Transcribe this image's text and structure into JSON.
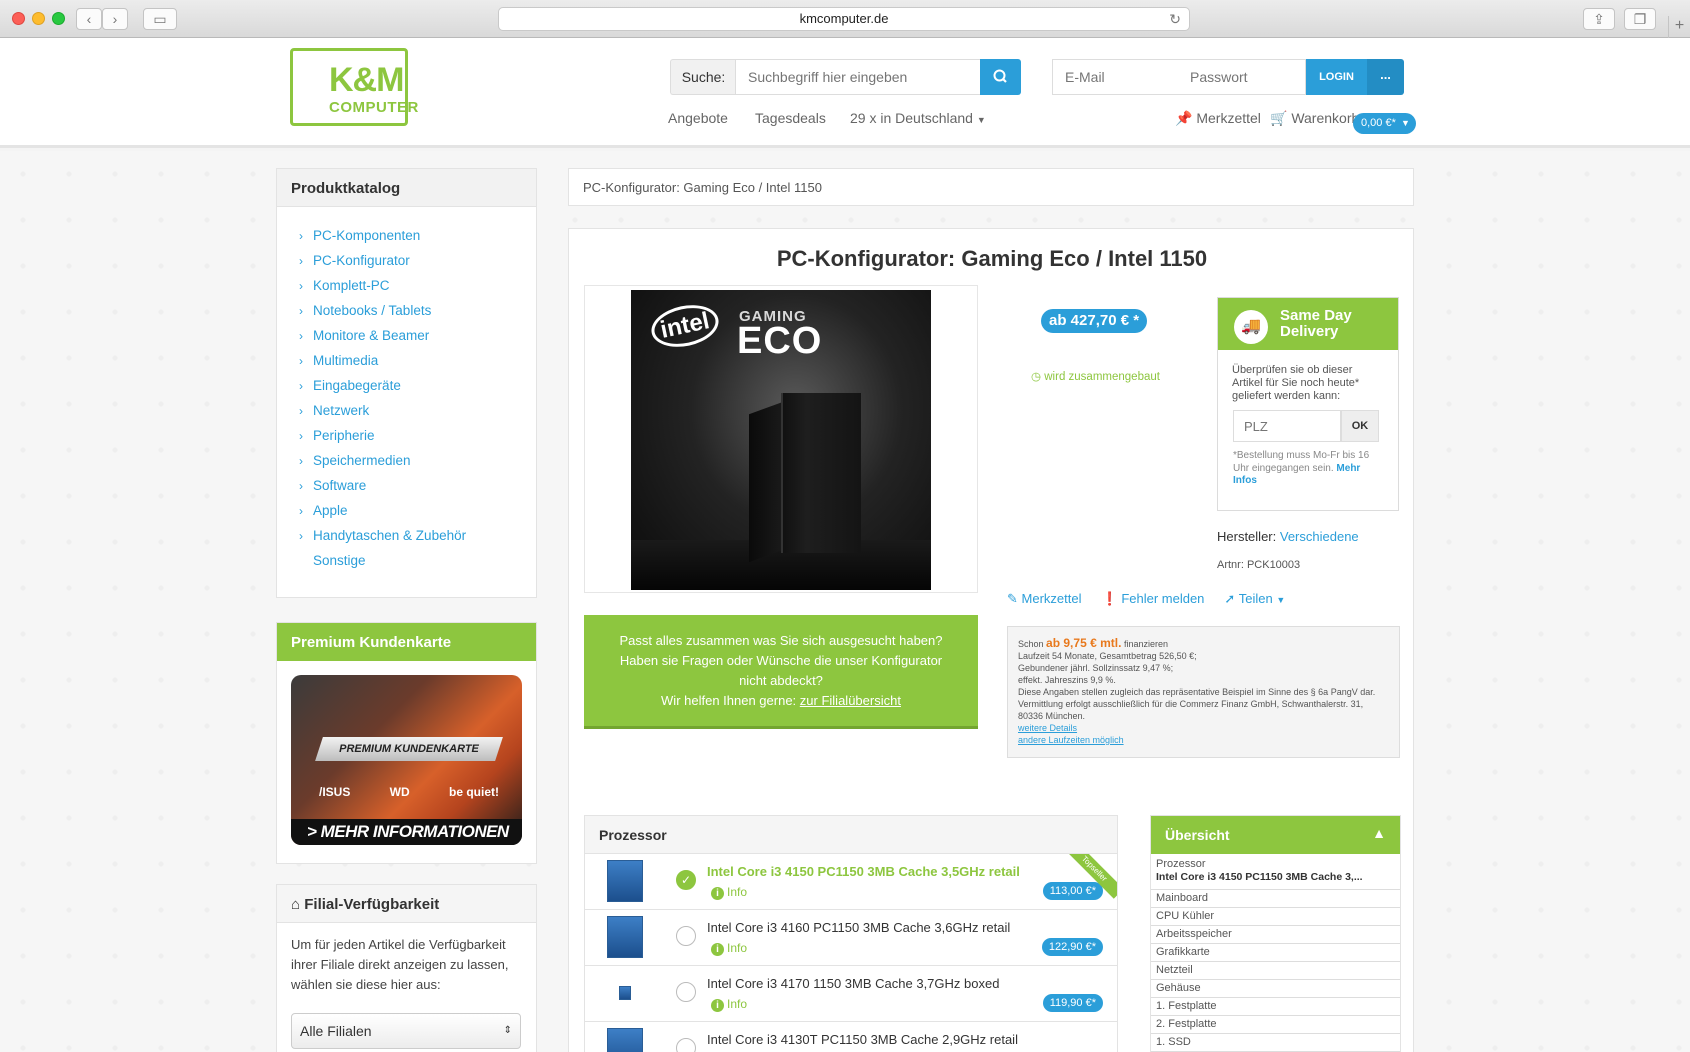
{
  "browser": {
    "url": "kmcomputer.de"
  },
  "header": {
    "logo_line1": "K&M",
    "logo_line2": "COMPUTER",
    "search_label": "Suche:",
    "search_placeholder": "Suchbegriff hier eingeben",
    "email_placeholder": "E-Mail",
    "password_placeholder": "Passwort",
    "login_label": "LOGIN",
    "more_label": "...",
    "nav": [
      "Angebote",
      "Tagesdeals",
      "29 x in Deutschland"
    ],
    "merkzettel": "Merkzettel",
    "warenkorb": "Warenkorb",
    "cart_total": "0,00 €*"
  },
  "sidebar": {
    "catalog_title": "Produktkatalog",
    "categories": [
      "PC-Komponenten",
      "PC-Konfigurator",
      "Komplett-PC",
      "Notebooks / Tablets",
      "Monitore & Beamer",
      "Multimedia",
      "Eingabegeräte",
      "Netzwerk",
      "Peripherie",
      "Speichermedien",
      "Software",
      "Apple",
      "Handytaschen & Zubehör"
    ],
    "categories_extra": "Sonstige",
    "premium_title": "Premium Kundenkarte",
    "card_label": "PREMIUM KUNDENKARTE",
    "card_cta": "> MEHR INFORMATIONEN",
    "card_brands": [
      "/ISUS",
      "WD",
      "be quiet!"
    ],
    "filial_title": "Filial-Verfügbarkeit",
    "filial_text": "Um für jeden Artikel die Verfügbarkeit ihrer Filiale direkt anzeigen zu lassen, wählen sie diese hier aus:",
    "filial_select": "Alle Filialen"
  },
  "breadcrumb": "PC-Konfigurator: Gaming Eco / Intel 1150",
  "product": {
    "title": "PC-Konfigurator: Gaming Eco / Intel 1150",
    "image_intel": "intel",
    "image_gaming": "GAMING",
    "image_eco": "ECO",
    "price": "ab 427,70 € *",
    "assembled": "wird zusammengebaut",
    "manufacturer_label": "Hersteller:",
    "manufacturer": "Verschiedene",
    "artnr": "Artnr: PCK10003",
    "actions": [
      "Merkzettel",
      "Fehler melden",
      "Teilen"
    ]
  },
  "same_day": {
    "title": "Same Day Delivery",
    "text": "Überprüfen sie ob dieser Artikel für Sie noch heute* geliefert werden kann:",
    "plz_placeholder": "PLZ",
    "ok_label": "OK",
    "note": "*Bestellung muss Mo-Fr bis 16 Uhr eingegangen sein.",
    "note_link": "Mehr Infos"
  },
  "help_box": {
    "line1": "Passt alles zusammen was Sie sich ausgesucht haben?",
    "line2": "Haben sie Fragen oder Wünsche die unser Konfigurator nicht abdeckt?",
    "line3": "Wir helfen Ihnen gerne:",
    "link": "zur Filialübersicht"
  },
  "finance": {
    "prefix": "Schon",
    "rate": "ab 9,75 € mtl.",
    "suffix": "finanzieren",
    "lines": [
      "Laufzeit 54 Monate, Gesamtbetrag 526,50 €;",
      "Gebundener jährl. Sollzinssatz 9,47 %;",
      "effekt. Jahreszins 9,9 %.",
      "Diese Angaben stellen zugleich das repräsentative Beispiel im Sinne des § 6a PangV dar.",
      "Vermittlung erfolgt ausschließlich für die Commerz Finanz GmbH, Schwanthalerstr. 31, 80336 München."
    ],
    "link1": "weitere Details",
    "link2": "andere Laufzeiten möglich"
  },
  "processor": {
    "title": "Prozessor",
    "ribbon": "Topseller",
    "info_label": "Info",
    "rows": [
      {
        "name": "Intel Core i3 4150 PC1150 3MB Cache 3,5GHz retail",
        "price": "113,00 €*"
      },
      {
        "name": "Intel Core i3 4160 PC1150 3MB Cache 3,6GHz retail",
        "price": "122,90 €*"
      },
      {
        "name": "Intel Core i3 4170 1150 3MB Cache 3,7GHz boxed",
        "price": "119,90 €*"
      },
      {
        "name": "Intel Core i3 4130T PC1150 3MB Cache 2,9GHz retail",
        "price": ""
      }
    ]
  },
  "overview": {
    "title": "Übersicht",
    "first_label": "Prozessor",
    "first_value": "Intel Core i3 4150 PC1150 3MB Cache 3,...",
    "items": [
      "Mainboard",
      "CPU Kühler",
      "Arbeitsspeicher",
      "Grafikkarte",
      "Netzteil",
      "Gehäuse",
      "1. Festplatte",
      "2. Festplatte",
      "1. SSD"
    ]
  }
}
